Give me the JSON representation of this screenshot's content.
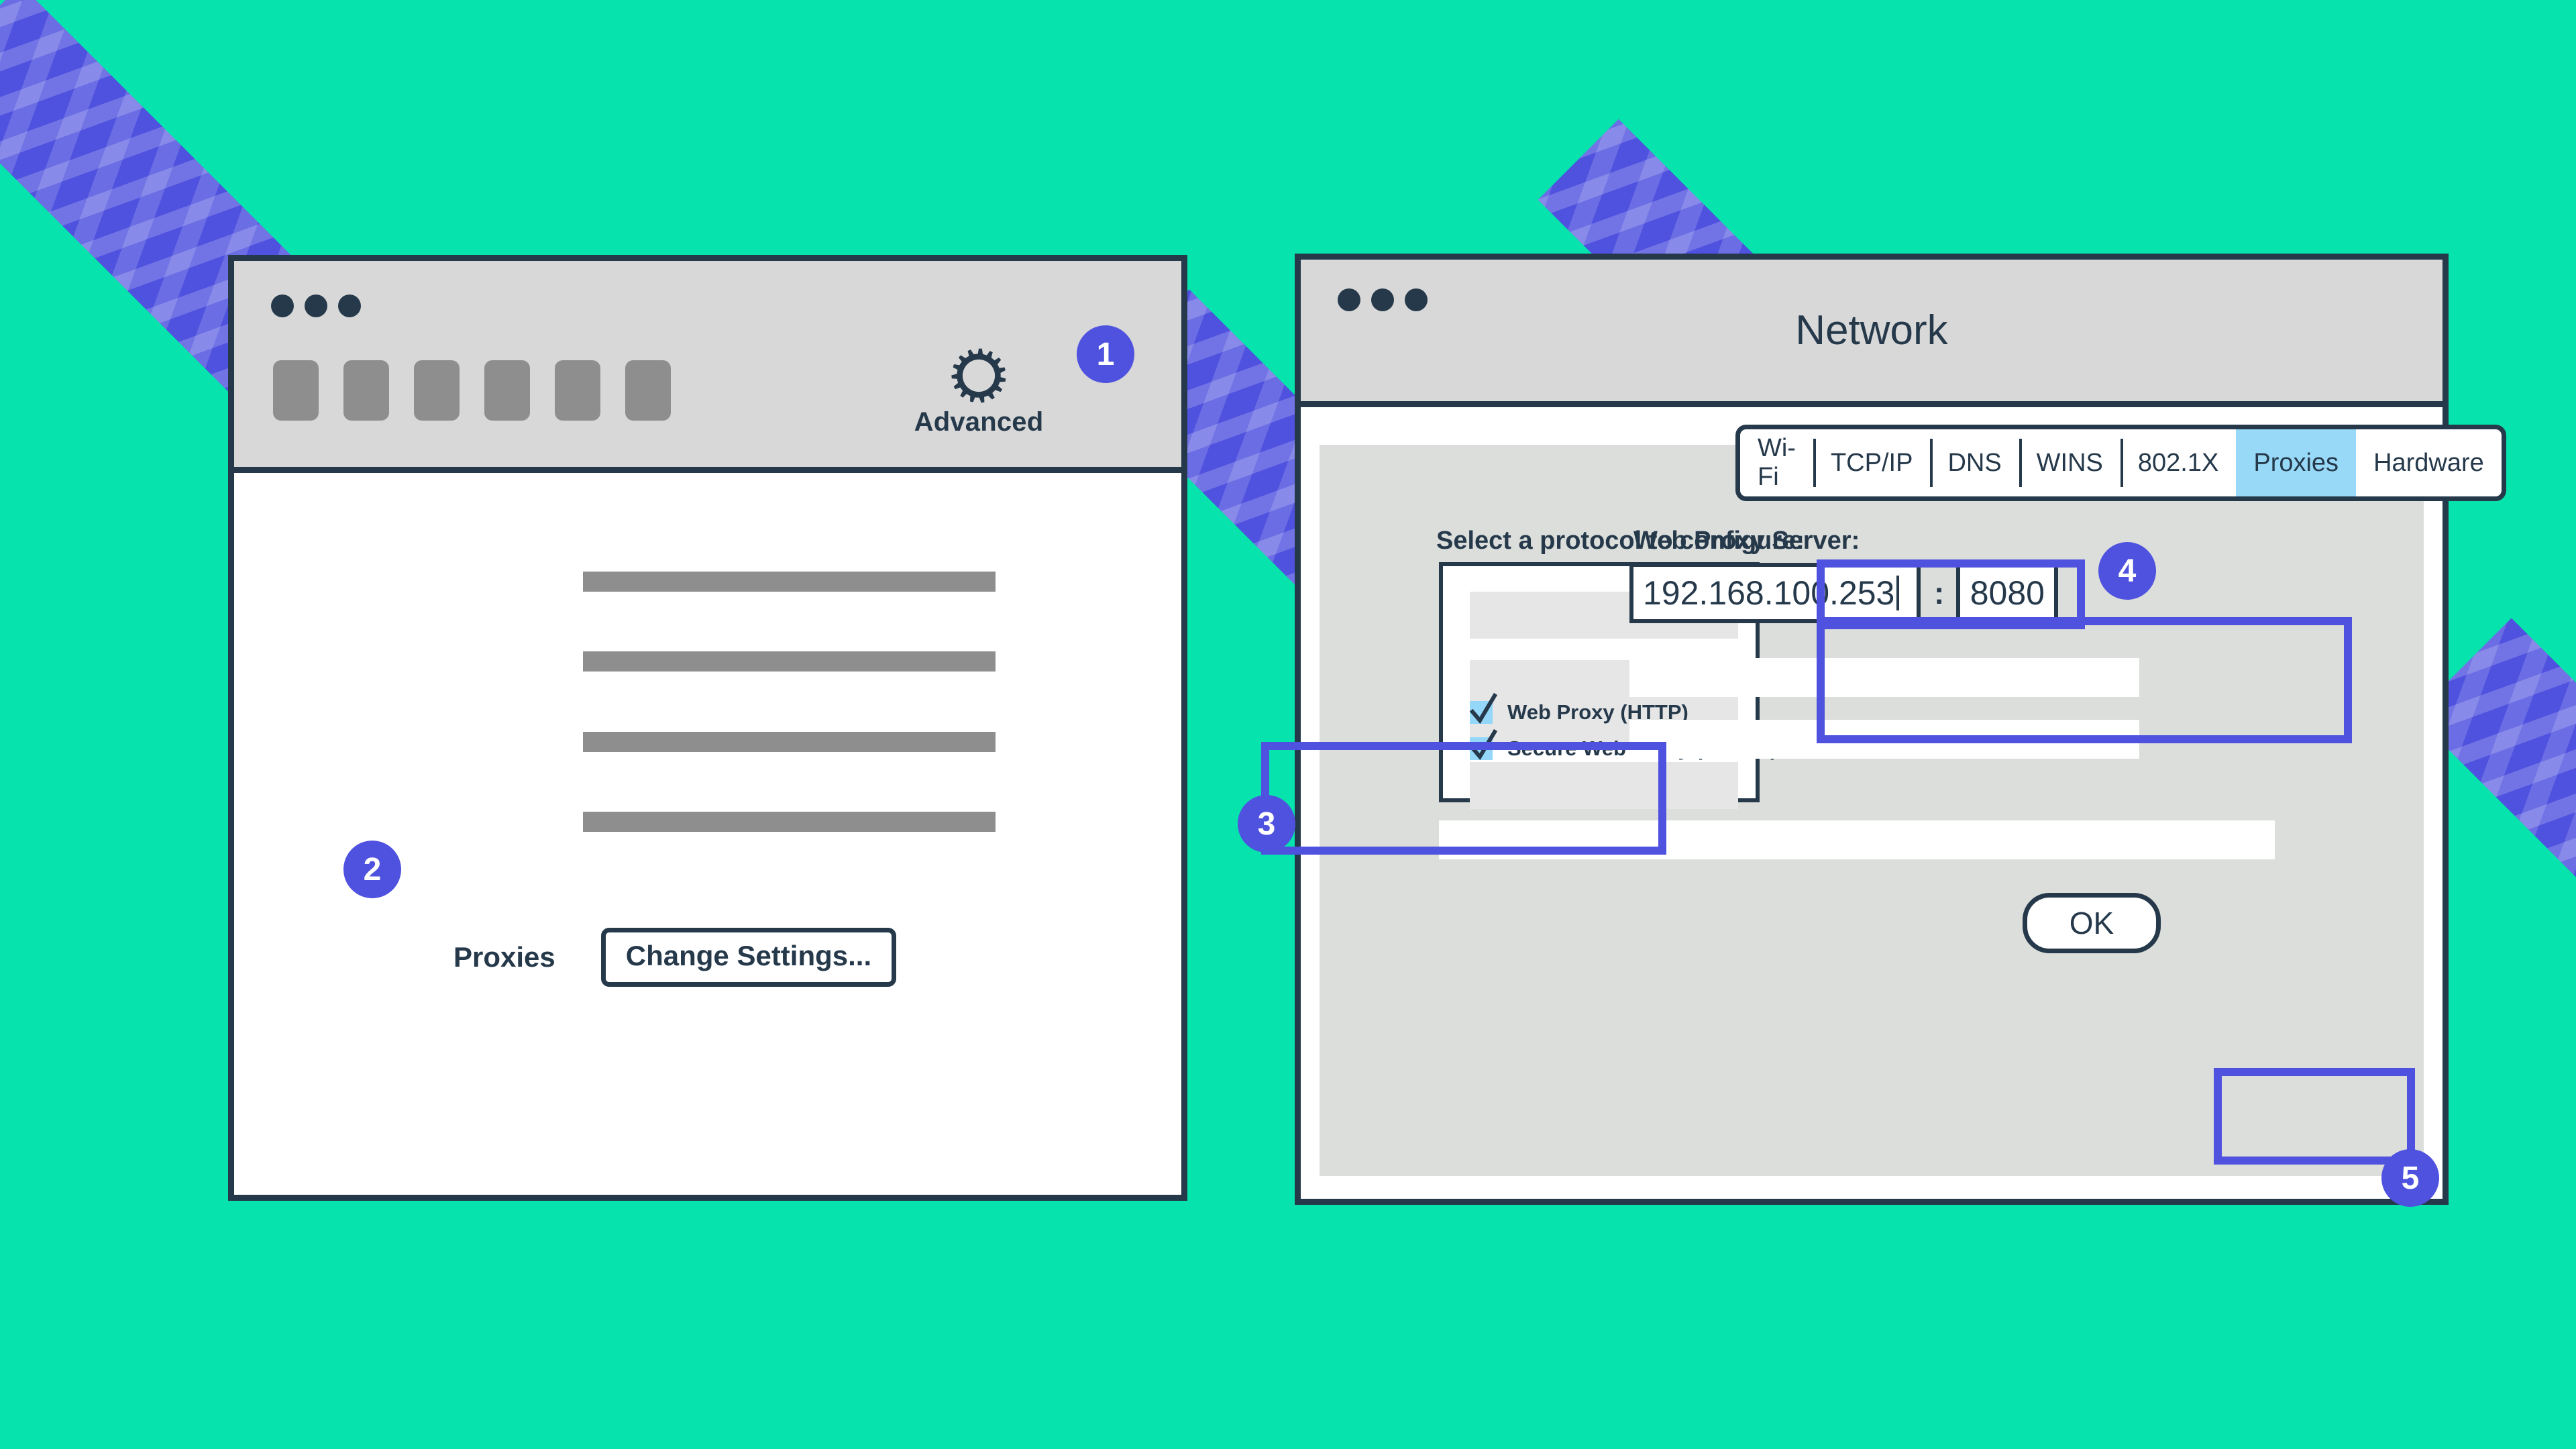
{
  "theme": {
    "background": "#06E3AC",
    "accent": "#4F51DF",
    "ink": "#25394B",
    "chrome_gray": "#D8D8D8",
    "sheet_gray": "#DCDEDB",
    "tab_active": "#98D9F7",
    "checkbox_fill": "#94D7F8",
    "placeholder_gray": "#8E8E8E"
  },
  "left_window": {
    "traffic_lights": 3,
    "toolbar_icon_count": 6,
    "advanced": {
      "icon": "gear-icon",
      "label": "Advanced"
    },
    "placeholder_line_count": 4,
    "proxies_label": "Proxies",
    "change_settings_button": "Change Settings..."
  },
  "right_window": {
    "title": "Network",
    "traffic_lights": 3,
    "tabs": [
      {
        "label": "Wi-Fi",
        "active": false
      },
      {
        "label": "TCP/IP",
        "active": false
      },
      {
        "label": "DNS",
        "active": false
      },
      {
        "label": "WINS",
        "active": false
      },
      {
        "label": "802.1X",
        "active": false
      },
      {
        "label": "Proxies",
        "active": true
      },
      {
        "label": "Hardware",
        "active": false
      }
    ],
    "protocol_label": "Select a protocol to configure:",
    "protocols": [
      {
        "label": "Web Proxy  (HTTP)",
        "checked": true
      },
      {
        "label": "Secure Web Proxy  (HTTPS)",
        "checked": true
      }
    ],
    "proxy_server_label": "Web Proxy Server:",
    "proxy_server_host": "192.168.100.253",
    "port_separator": ":",
    "proxy_server_port": "8080",
    "ok_button": "OK"
  },
  "step_badges": [
    {
      "number": "1"
    },
    {
      "number": "2"
    },
    {
      "number": "3"
    },
    {
      "number": "4"
    },
    {
      "number": "5"
    }
  ]
}
